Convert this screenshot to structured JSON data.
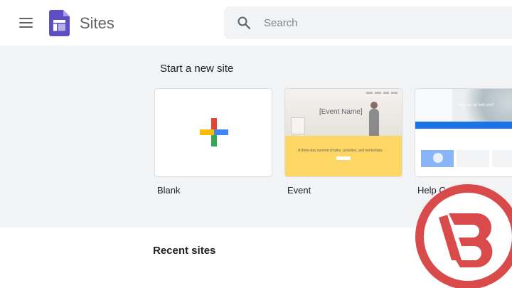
{
  "header": {
    "app_name": "Sites",
    "menu_icon": "hamburger-menu-icon",
    "logo_icon": "google-sites-logo",
    "search": {
      "placeholder": "Search",
      "value": "",
      "icon": "search-icon"
    }
  },
  "templates": {
    "section_title": "Start a new site",
    "items": [
      {
        "label": "Blank",
        "icon": "plus-icon"
      },
      {
        "label": "Event",
        "preview": {
          "event_name": "[Event Name]",
          "tagline": "A three-day summit of talks, activities, and workshops"
        }
      },
      {
        "label": "Help Ce",
        "preview": {
          "question": "How can we help you?"
        }
      }
    ]
  },
  "recent": {
    "section_title": "Recent sites"
  },
  "colors": {
    "header_bg": "#ffffff",
    "templates_bg": "#f1f3f4",
    "sites_purple": "#4c3f9c",
    "google_red": "#ea4335",
    "google_yellow": "#fbbc04",
    "google_green": "#34a853",
    "google_blue": "#4285f4",
    "watermark_red": "#d94a4a"
  },
  "watermark": {
    "icon": "channel-logo-b-icon"
  }
}
